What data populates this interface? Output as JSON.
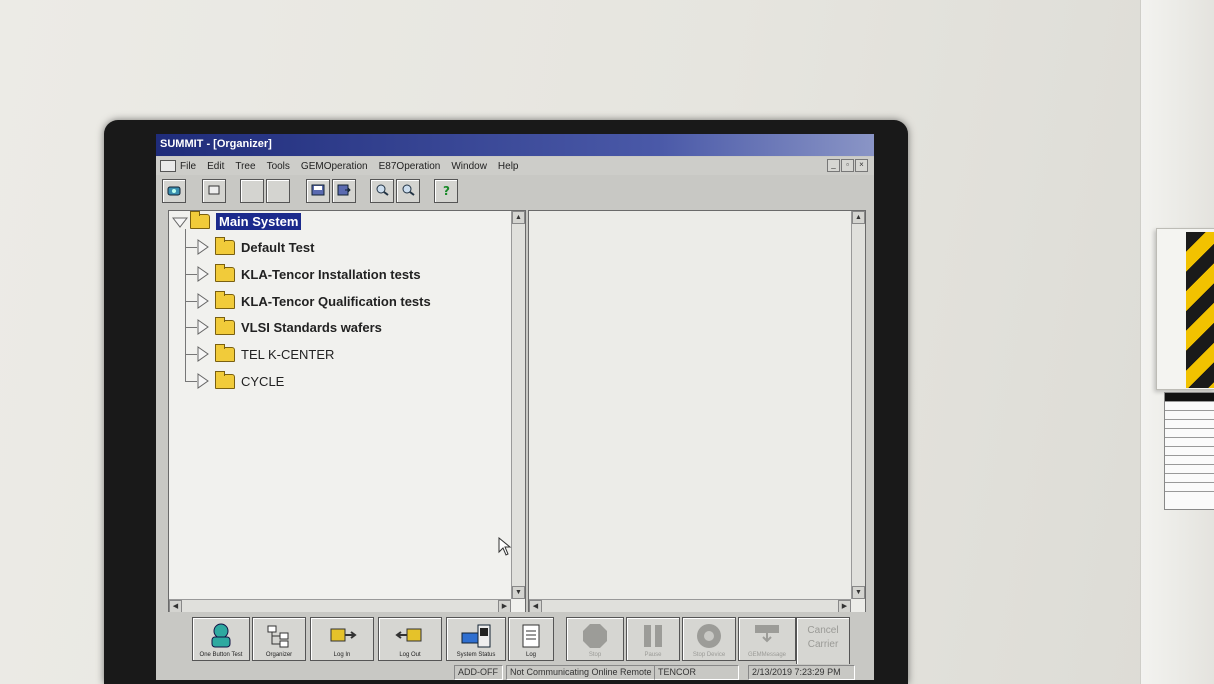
{
  "window": {
    "title": "SUMMIT - [Organizer]"
  },
  "menu": {
    "items": [
      "File",
      "Edit",
      "Tree",
      "Tools",
      "GEMOperation",
      "E87Operation",
      "Window",
      "Help"
    ]
  },
  "mdi_controls": [
    "_",
    "×"
  ],
  "tree": {
    "root": "Main System",
    "children": [
      "Default Test",
      "KLA-Tencor Installation tests",
      "KLA-Tencor Qualification tests",
      "VLSI Standards wafers",
      "TEL K-CENTER",
      "CYCLE"
    ]
  },
  "bottom_buttons": {
    "one_button_test": "One Button Test",
    "organizer": "Organizer",
    "log_in": "Log In",
    "log_out": "Log Out",
    "system_status": "System Status",
    "log": "Log",
    "stop": "Stop",
    "pause": "Pause",
    "stop_device": "Stop Device",
    "gem_message": "GEMMessage",
    "cancel_carrier_1": "Cancel",
    "cancel_carrier_2": "Carrier"
  },
  "status_bar": {
    "mode": "ADD-OFF",
    "comm": "Not Communicating Online Remote",
    "user": "TENCOR",
    "datetime": "2/13/2019  7:23:29 PM"
  },
  "colors": {
    "title_bar": "#1f2c7a",
    "folder": "#f1cb3a",
    "selection": "#1b2a8c"
  }
}
